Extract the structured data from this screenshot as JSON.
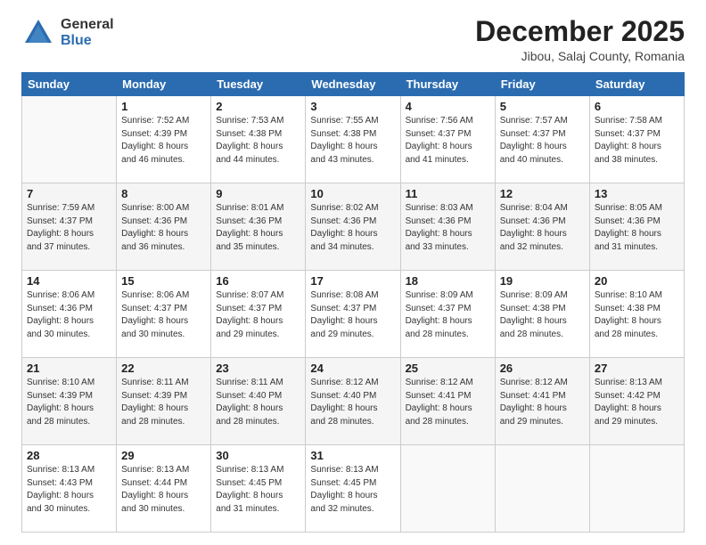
{
  "header": {
    "logo_line1": "General",
    "logo_line2": "Blue",
    "month": "December 2025",
    "location": "Jibou, Salaj County, Romania"
  },
  "weekdays": [
    "Sunday",
    "Monday",
    "Tuesday",
    "Wednesday",
    "Thursday",
    "Friday",
    "Saturday"
  ],
  "weeks": [
    [
      {
        "day": "",
        "info": ""
      },
      {
        "day": "1",
        "info": "Sunrise: 7:52 AM\nSunset: 4:39 PM\nDaylight: 8 hours\nand 46 minutes."
      },
      {
        "day": "2",
        "info": "Sunrise: 7:53 AM\nSunset: 4:38 PM\nDaylight: 8 hours\nand 44 minutes."
      },
      {
        "day": "3",
        "info": "Sunrise: 7:55 AM\nSunset: 4:38 PM\nDaylight: 8 hours\nand 43 minutes."
      },
      {
        "day": "4",
        "info": "Sunrise: 7:56 AM\nSunset: 4:37 PM\nDaylight: 8 hours\nand 41 minutes."
      },
      {
        "day": "5",
        "info": "Sunrise: 7:57 AM\nSunset: 4:37 PM\nDaylight: 8 hours\nand 40 minutes."
      },
      {
        "day": "6",
        "info": "Sunrise: 7:58 AM\nSunset: 4:37 PM\nDaylight: 8 hours\nand 38 minutes."
      }
    ],
    [
      {
        "day": "7",
        "info": "Sunrise: 7:59 AM\nSunset: 4:37 PM\nDaylight: 8 hours\nand 37 minutes."
      },
      {
        "day": "8",
        "info": "Sunrise: 8:00 AM\nSunset: 4:36 PM\nDaylight: 8 hours\nand 36 minutes."
      },
      {
        "day": "9",
        "info": "Sunrise: 8:01 AM\nSunset: 4:36 PM\nDaylight: 8 hours\nand 35 minutes."
      },
      {
        "day": "10",
        "info": "Sunrise: 8:02 AM\nSunset: 4:36 PM\nDaylight: 8 hours\nand 34 minutes."
      },
      {
        "day": "11",
        "info": "Sunrise: 8:03 AM\nSunset: 4:36 PM\nDaylight: 8 hours\nand 33 minutes."
      },
      {
        "day": "12",
        "info": "Sunrise: 8:04 AM\nSunset: 4:36 PM\nDaylight: 8 hours\nand 32 minutes."
      },
      {
        "day": "13",
        "info": "Sunrise: 8:05 AM\nSunset: 4:36 PM\nDaylight: 8 hours\nand 31 minutes."
      }
    ],
    [
      {
        "day": "14",
        "info": "Sunrise: 8:06 AM\nSunset: 4:36 PM\nDaylight: 8 hours\nand 30 minutes."
      },
      {
        "day": "15",
        "info": "Sunrise: 8:06 AM\nSunset: 4:37 PM\nDaylight: 8 hours\nand 30 minutes."
      },
      {
        "day": "16",
        "info": "Sunrise: 8:07 AM\nSunset: 4:37 PM\nDaylight: 8 hours\nand 29 minutes."
      },
      {
        "day": "17",
        "info": "Sunrise: 8:08 AM\nSunset: 4:37 PM\nDaylight: 8 hours\nand 29 minutes."
      },
      {
        "day": "18",
        "info": "Sunrise: 8:09 AM\nSunset: 4:37 PM\nDaylight: 8 hours\nand 28 minutes."
      },
      {
        "day": "19",
        "info": "Sunrise: 8:09 AM\nSunset: 4:38 PM\nDaylight: 8 hours\nand 28 minutes."
      },
      {
        "day": "20",
        "info": "Sunrise: 8:10 AM\nSunset: 4:38 PM\nDaylight: 8 hours\nand 28 minutes."
      }
    ],
    [
      {
        "day": "21",
        "info": "Sunrise: 8:10 AM\nSunset: 4:39 PM\nDaylight: 8 hours\nand 28 minutes."
      },
      {
        "day": "22",
        "info": "Sunrise: 8:11 AM\nSunset: 4:39 PM\nDaylight: 8 hours\nand 28 minutes."
      },
      {
        "day": "23",
        "info": "Sunrise: 8:11 AM\nSunset: 4:40 PM\nDaylight: 8 hours\nand 28 minutes."
      },
      {
        "day": "24",
        "info": "Sunrise: 8:12 AM\nSunset: 4:40 PM\nDaylight: 8 hours\nand 28 minutes."
      },
      {
        "day": "25",
        "info": "Sunrise: 8:12 AM\nSunset: 4:41 PM\nDaylight: 8 hours\nand 28 minutes."
      },
      {
        "day": "26",
        "info": "Sunrise: 8:12 AM\nSunset: 4:41 PM\nDaylight: 8 hours\nand 29 minutes."
      },
      {
        "day": "27",
        "info": "Sunrise: 8:13 AM\nSunset: 4:42 PM\nDaylight: 8 hours\nand 29 minutes."
      }
    ],
    [
      {
        "day": "28",
        "info": "Sunrise: 8:13 AM\nSunset: 4:43 PM\nDaylight: 8 hours\nand 30 minutes."
      },
      {
        "day": "29",
        "info": "Sunrise: 8:13 AM\nSunset: 4:44 PM\nDaylight: 8 hours\nand 30 minutes."
      },
      {
        "day": "30",
        "info": "Sunrise: 8:13 AM\nSunset: 4:45 PM\nDaylight: 8 hours\nand 31 minutes."
      },
      {
        "day": "31",
        "info": "Sunrise: 8:13 AM\nSunset: 4:45 PM\nDaylight: 8 hours\nand 32 minutes."
      },
      {
        "day": "",
        "info": ""
      },
      {
        "day": "",
        "info": ""
      },
      {
        "day": "",
        "info": ""
      }
    ]
  ]
}
